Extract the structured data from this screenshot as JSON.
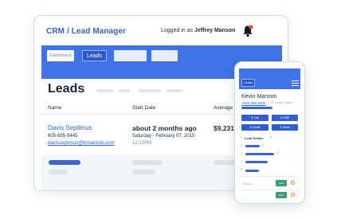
{
  "desktop": {
    "app_title": "CRM / Lead Manager",
    "logged_in_prefix": "Logged in as",
    "user_name": "Jeffrey Manson",
    "tabs": [
      {
        "label": "Dashboard",
        "state": "inactive"
      },
      {
        "label": "Leads",
        "state": "active"
      },
      {
        "label": "",
        "state": "blank"
      },
      {
        "label": "",
        "state": "blank"
      }
    ],
    "page_heading": "Leads",
    "columns": {
      "name": "Name",
      "start_date": "Start Date",
      "average": "Average F"
    },
    "lead": {
      "name": "Davis Septimus",
      "phone": "605-895-9445",
      "email": "davisseptimus@khoantuto.com",
      "start_relative": "about 2 months ago",
      "start_date": "Saturday - February 07, 2015",
      "start_time": "12:12PM",
      "average": "$9,231,"
    }
  },
  "mobile": {
    "tab_label": "Leads",
    "contact_name": "Kevin Manson",
    "contact_phone": "+605-895-9445",
    "contact_location": "SF United States",
    "buttons": [
      "Call",
      "SMS",
      "Email",
      "Notes"
    ],
    "lead_details_label": "Lead Details",
    "setting_label": "Setting",
    "action_labels": [
      "Edit",
      "Edit"
    ]
  },
  "colors": {
    "accent": "#3f74e8",
    "active_tab": "#2c57c4",
    "link": "#2f63cf",
    "bell": "#e3572b",
    "success": "#3d9d7a",
    "warning": "#e38b2c"
  },
  "icons": {
    "notification": "bell-icon",
    "menu": "hamburger-icon",
    "call": "phone-icon",
    "sms": "message-icon",
    "email": "mail-icon",
    "notes": "note-icon"
  }
}
